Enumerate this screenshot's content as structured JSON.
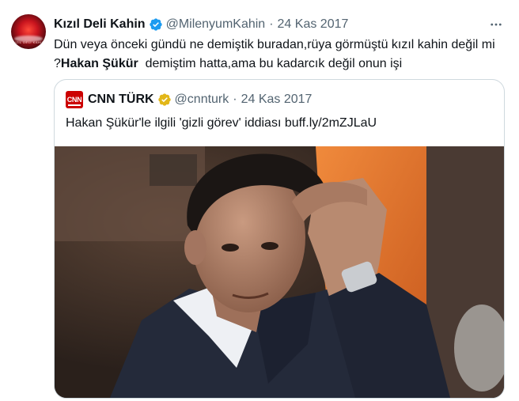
{
  "tweet": {
    "name": "Kızıl Deli Kahin",
    "handle": "@MilenyumKahin",
    "separator": "·",
    "date": "24 Kas 2017",
    "text_part1": "Dün veya önceki gündü ne demiştik buradan,rüya görmüştü kızıl kahin değil mi ?",
    "text_bold": "Hakan Şükür",
    "text_part2": "  demiştim hatta,ama bu kadarcık değil onun işi",
    "avatar_caption": "KIZIL DELİ KAHİN"
  },
  "quote": {
    "name": "CNN TÜRK",
    "handle": "@cnnturk",
    "separator": "·",
    "date": "24 Kas 2017",
    "text": "Hakan Şükür'le ilgili 'gizli görev' iddiası buff.ly/2mZJLaU",
    "logo_text": "CNN"
  },
  "colors": {
    "verified_blue": "#1d9bf0",
    "verified_gold": "#e2b719",
    "secondary_text": "#536471",
    "border": "#cfd9de"
  },
  "icons": {
    "verified": "verified-badge-icon",
    "gold": "gold-verified-badge-icon",
    "more": "more-horizontal-icon"
  }
}
